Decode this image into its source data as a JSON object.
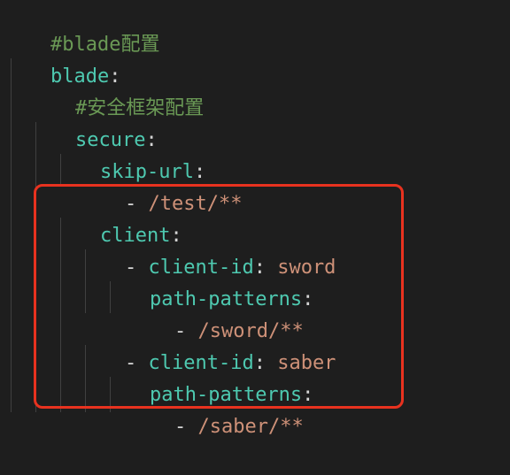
{
  "lines": [
    {
      "comment": "#blade配置"
    },
    {
      "key": "blade",
      "punct": ":"
    },
    {
      "comment": "#安全框架配置"
    },
    {
      "key": "secure",
      "punct": ":"
    },
    {
      "key": "skip-url",
      "punct": ":"
    },
    {
      "dash": "- ",
      "value": "/test/**"
    },
    {
      "key": "client",
      "punct": ":"
    },
    {
      "dash": "- ",
      "key": "client-id",
      "punct": ": ",
      "value": "sword"
    },
    {
      "key": "path-patterns",
      "punct": ":"
    },
    {
      "dash": "- ",
      "value": "/sword/**"
    },
    {
      "dash": "- ",
      "key": "client-id",
      "punct": ": ",
      "value": "saber"
    },
    {
      "key": "path-patterns",
      "punct": ":"
    },
    {
      "dash": "- ",
      "value": "/saber/**"
    }
  ],
  "colors": {
    "background": "#1e1e1e",
    "comment": "#6a9955",
    "key": "#4ec9b0",
    "string": "#ce9178",
    "highlight_border": "#e8321f"
  }
}
